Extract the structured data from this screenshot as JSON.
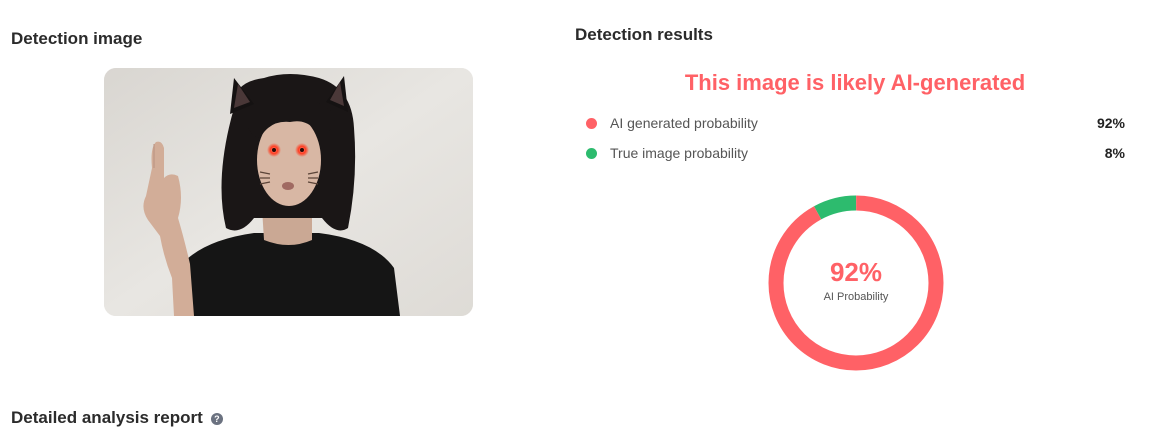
{
  "detection_image": {
    "heading": "Detection image"
  },
  "detection_results": {
    "heading": "Detection results",
    "verdict": "This image is likely AI-generated",
    "rows": [
      {
        "label": "AI generated probability",
        "value": "92%",
        "color": "#ff6166"
      },
      {
        "label": "True image probability",
        "value": "8%",
        "color": "#2dbb6e"
      }
    ],
    "donut": {
      "ai_fraction": 0.92,
      "true_fraction": 0.08,
      "center_value": "92%",
      "center_label": "AI Probability"
    }
  },
  "report": {
    "heading": "Detailed analysis report",
    "help_icon": "question-circle-icon",
    "help_glyph": "?"
  },
  "colors": {
    "ai_red": "#ff6166",
    "true_green": "#2dbb6e",
    "heading": "#2b2b2b"
  }
}
